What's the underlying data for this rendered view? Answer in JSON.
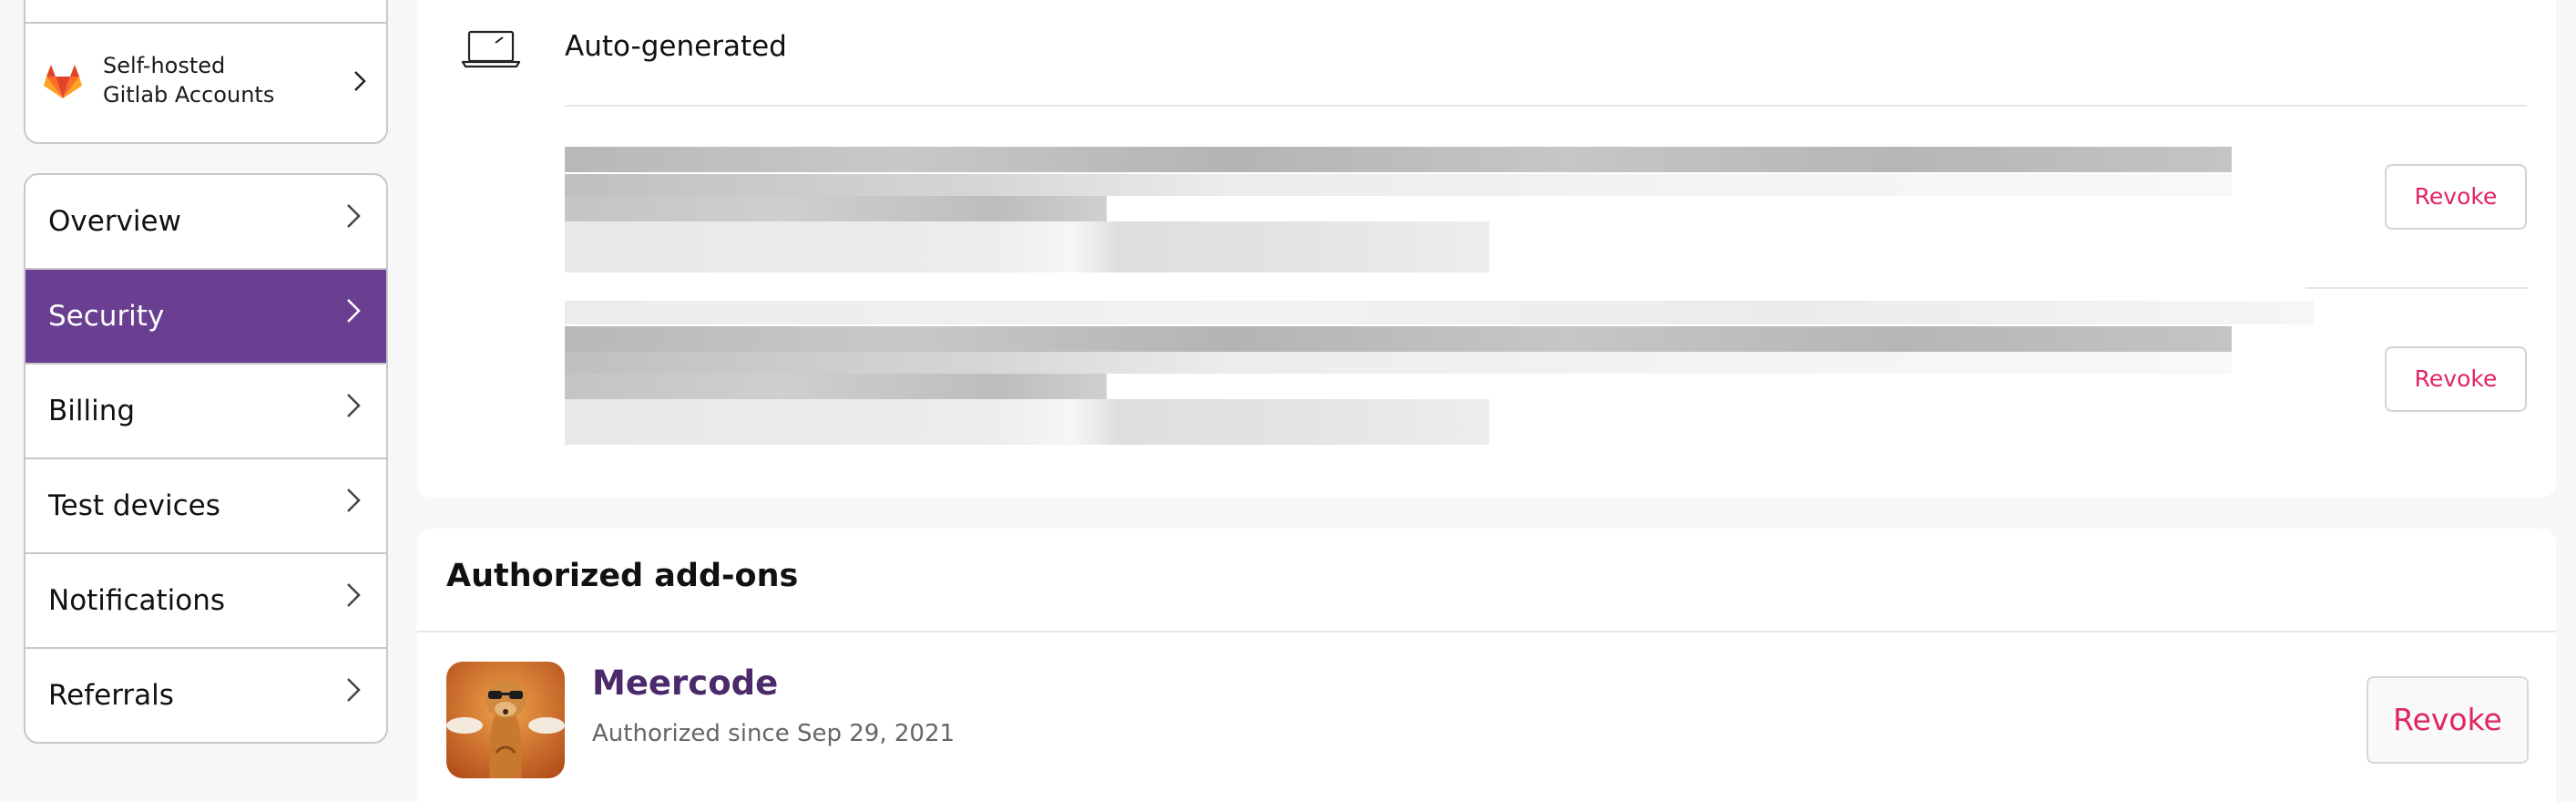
{
  "sidebar": {
    "gitlab_label_line1": "Self-hosted",
    "gitlab_label_line2": "Gitlab Accounts",
    "items": [
      {
        "label": "Overview"
      },
      {
        "label": "Security"
      },
      {
        "label": "Billing"
      },
      {
        "label": "Test devices"
      },
      {
        "label": "Notifications"
      },
      {
        "label": "Referrals"
      }
    ],
    "active_item": "Security"
  },
  "tokens": {
    "title": "Auto-generated",
    "revoke_label": "Revoke"
  },
  "addons": {
    "heading": "Authorized add-ons",
    "items": [
      {
        "name": "Meercode",
        "since": "Authorized since Sep 29, 2021",
        "revoke_label": "Revoke"
      }
    ]
  },
  "colors": {
    "accent_purple": "#6a3f92",
    "revoke_red": "#e0245e",
    "addon_name": "#4a2a6b"
  }
}
